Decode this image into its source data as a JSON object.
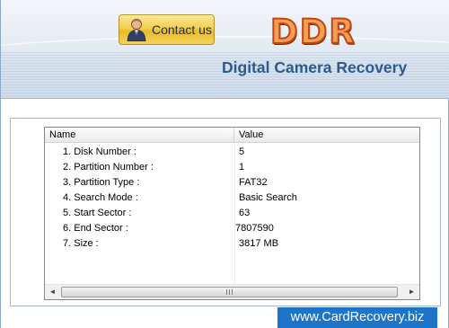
{
  "header": {
    "contact_label": "Contact us",
    "logo_text": "DDR",
    "app_title": "Digital Camera Recovery"
  },
  "table": {
    "columns": [
      "Name",
      "Value"
    ],
    "rows": [
      {
        "name": "1. Disk Number :",
        "value": "5"
      },
      {
        "name": "2. Partition Number :",
        "value": "1"
      },
      {
        "name": "3. Partition Type :",
        "value": "FAT32"
      },
      {
        "name": "4. Search Mode :",
        "value": "Basic Search"
      },
      {
        "name": "5. Start Sector :",
        "value": "63"
      },
      {
        "name": "6. End Sector :",
        "value": "7807590"
      },
      {
        "name": "7. Size :",
        "value": "3817 MB"
      }
    ]
  },
  "scrollbar": {
    "left_arrow": "◄",
    "right_arrow": "►"
  },
  "footer": {
    "url": "www.CardRecovery.biz"
  },
  "colors": {
    "logo": "#f0a050",
    "title": "#2b5a8e",
    "footer_bg": "#1d74c8"
  },
  "icons": {
    "contact": "person-icon"
  }
}
